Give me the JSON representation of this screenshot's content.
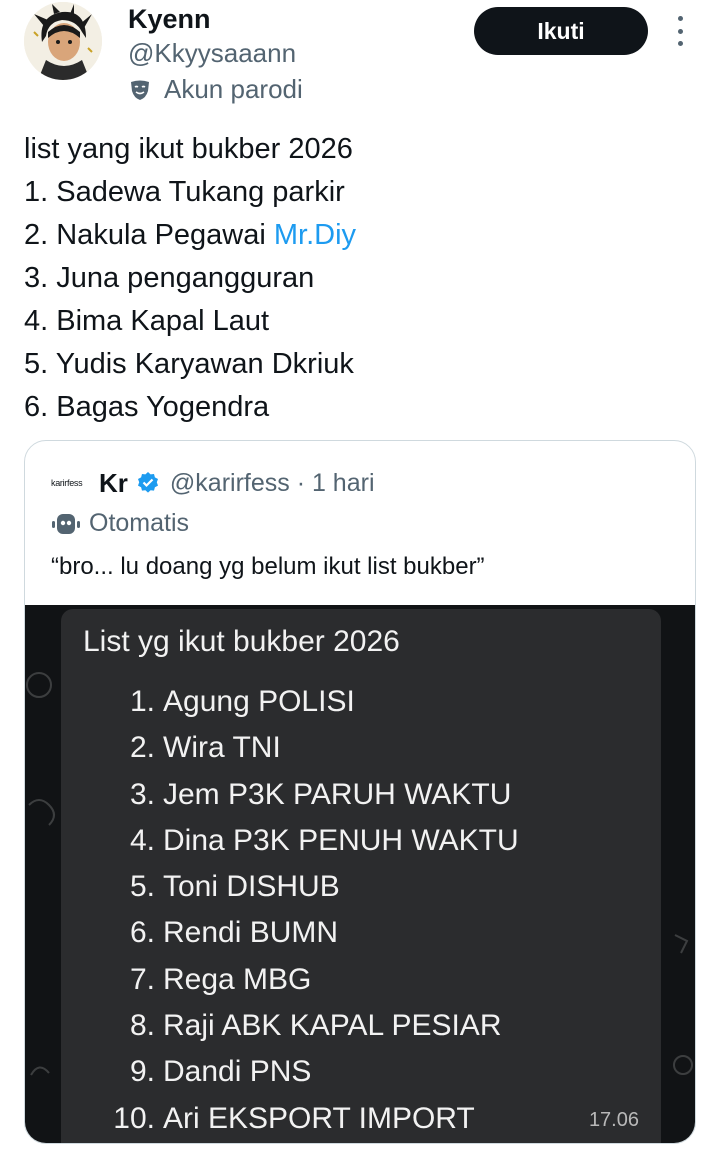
{
  "author": {
    "name": "Kyenn",
    "handle": "@Kkyysaaann",
    "label": "Akun parodi",
    "avatar_icon": "anime-avatar-icon",
    "parody_icon": "mask-icon"
  },
  "actions": {
    "follow_label": "Ikuti",
    "more_icon": "more-vertical-icon"
  },
  "tweet": {
    "lines": [
      "list yang ikut bukber 2026",
      "1. Sadewa Tukang parkir",
      "2. Nakula Pegawai ",
      "3. Juna pengangguran",
      "4. Bima Kapal Laut",
      "5. Yudis Karyawan Dkriuk",
      "6. Bagas Yogendra"
    ],
    "link_text": "Mr.Diy",
    "link_color": "#1d9bf0"
  },
  "quote": {
    "logo_text": "karirfess",
    "name": "Kr",
    "verified_icon": "verified-badge-icon",
    "handle_time": "@karirfess · 1 hari",
    "automated_label": "Otomatis",
    "automated_icon": "bot-icon",
    "text": "“bro... lu doang yg belum ikut list bukber”",
    "image": {
      "title": "List yg ikut bukber 2026",
      "items": [
        {
          "num": "1.",
          "text": "Agung POLISI"
        },
        {
          "num": "2.",
          "text": "Wira TNI"
        },
        {
          "num": "3.",
          "text": "Jem P3K PARUH WAKTU"
        },
        {
          "num": "4.",
          "text": "Dina P3K PENUH WAKTU"
        },
        {
          "num": "5.",
          "text": "Toni DISHUB"
        },
        {
          "num": "6.",
          "text": "Rendi BUMN"
        },
        {
          "num": "7.",
          "text": "Rega MBG"
        },
        {
          "num": "8.",
          "text": "Raji ABK KAPAL PESIAR"
        },
        {
          "num": "9.",
          "text": "Dandi PNS"
        },
        {
          "num": "10.",
          "text": "Ari EKSPORT IMPORT"
        }
      ],
      "time": "17.06"
    }
  },
  "colors": {
    "text": "#0f1419",
    "secondary": "#536471",
    "button_bg": "#0f1419",
    "border": "#cfd9de",
    "chat_bg": "#111315",
    "bubble_bg": "#2b2c2e"
  }
}
